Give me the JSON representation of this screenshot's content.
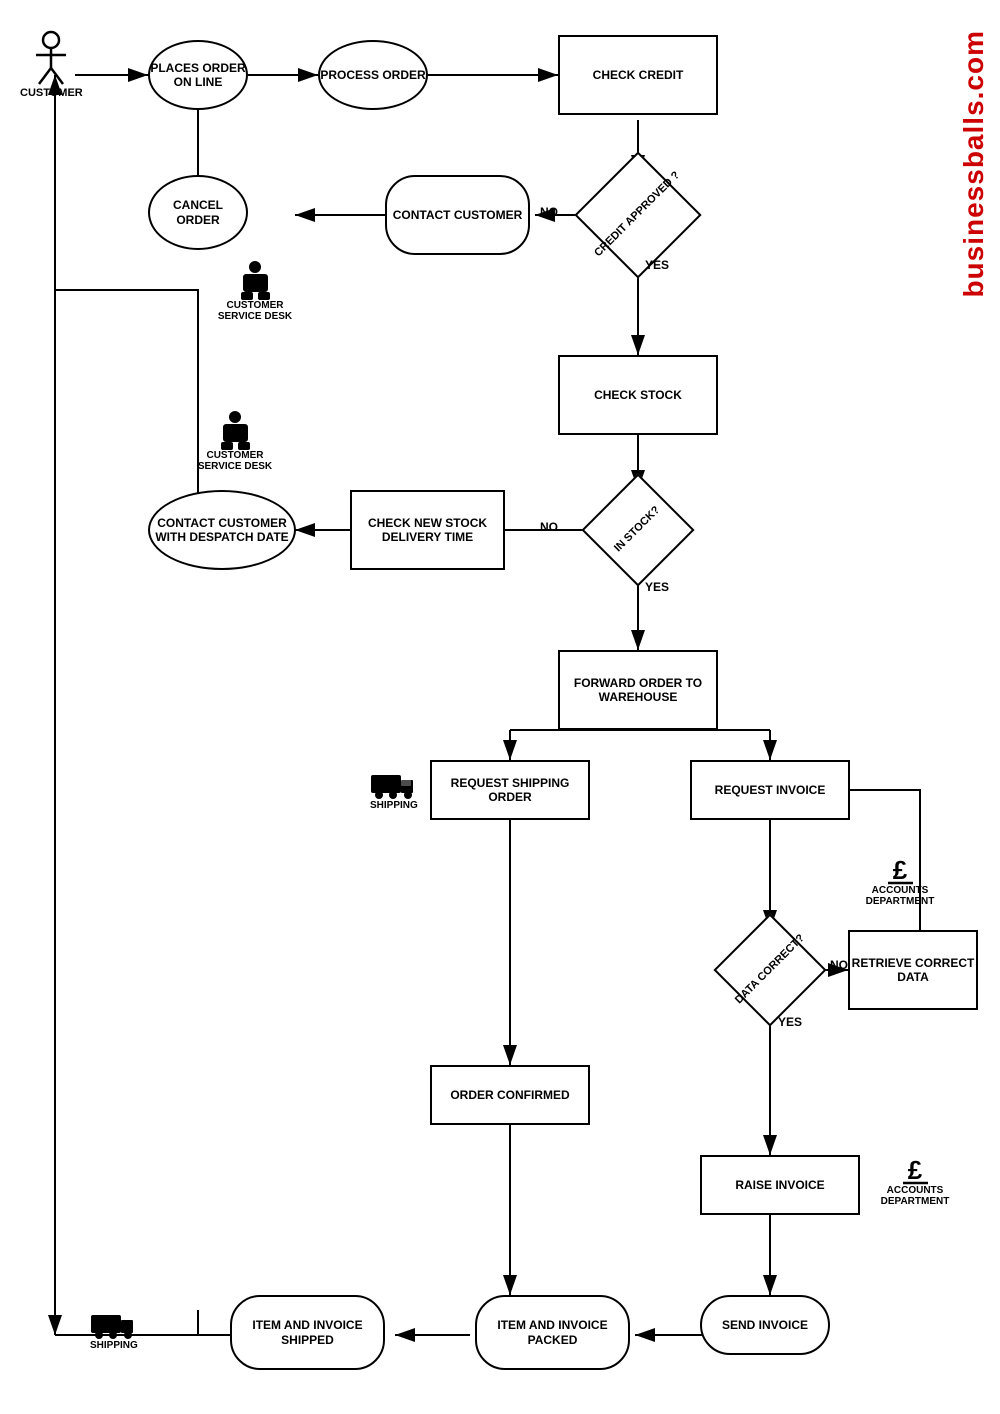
{
  "brand": "businessballs.com",
  "nodes": {
    "customer_label": "CUSTOMER",
    "places_order": "PLACES ORDER ON LINE",
    "process_order": "PROCESS ORDER",
    "check_credit": "CHECK CREDIT",
    "credit_approved": "CREDIT APPROVED ?",
    "contact_customer": "CONTACT CUSTOMER",
    "cancel_order": "CANCEL ORDER",
    "csd1": "CUSTOMER SERVICE DESK",
    "check_stock": "CHECK STOCK",
    "in_stock": "IN STOCK?",
    "check_new_stock": "CHECK NEW STOCK DELIVERY TIME",
    "contact_despatch": "CONTACT CUSTOMER WITH DESPATCH DATE",
    "csd2": "CUSTOMER SERVICE DESK",
    "forward_order": "FORWARD ORDER TO WAREHOUSE",
    "request_shipping": "REQUEST SHIPPING ORDER",
    "request_invoice": "REQUEST INVOICE",
    "shipping1": "SHIPPING",
    "data_correct": "DATA CORRECT?",
    "retrieve_data": "RETRIEVE CORRECT DATA",
    "accounts1": "ACCOUNTS DEPARTMENT",
    "order_confirmed": "ORDER CONFIRMED",
    "raise_invoice": "RAISE INVOICE",
    "accounts2": "ACCOUNTS DEPARTMENT",
    "send_invoice": "SEND INVOICE",
    "item_packed": "ITEM AND INVOICE PACKED",
    "item_shipped": "ITEM AND INVOICE SHIPPED",
    "shipping2": "SHIPPING",
    "no_label": "NO",
    "yes_label": "YES",
    "no_label2": "NO",
    "yes_label2": "YES",
    "no_label3": "NO",
    "yes_label3": "YES"
  }
}
